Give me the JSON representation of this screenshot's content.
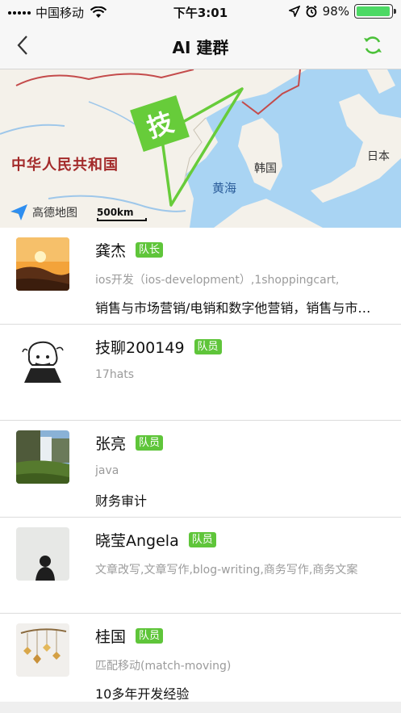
{
  "status_bar": {
    "carrier": "中国移动",
    "time": "下午3:01",
    "battery_text": "98%",
    "battery_level": 0.98
  },
  "nav": {
    "title": "AI 建群",
    "back_icon": "chevron-left-icon",
    "refresh_icon": "refresh-icon",
    "accent": "#4cc13a"
  },
  "map": {
    "label_country": "中华人民共和国",
    "label_korea": "韩国",
    "label_japan": "日本",
    "label_sea": "黄海",
    "marker_char": "技",
    "provider": "高德地图",
    "scale": "500km"
  },
  "members": [
    {
      "name": "龚杰",
      "role": "队长",
      "skills": "ios开发（ios-development）,1shoppingcart,",
      "description": "销售与市场营销/电销和数字他营销，销售与市场营销"
    },
    {
      "name": "技聊200149",
      "role": "队员",
      "skills": "17hats",
      "description": ""
    },
    {
      "name": "张亮",
      "role": "队员",
      "skills": "java",
      "description": "财务审计"
    },
    {
      "name": "晓莹Angela",
      "role": "队员",
      "skills": "文章改写,文章写作,blog-writing,商务写作,商务文案",
      "description": ""
    },
    {
      "name": "桂国",
      "role": "队员",
      "skills": "匹配移动(match-moving)",
      "description": "10多年开发经验"
    }
  ]
}
